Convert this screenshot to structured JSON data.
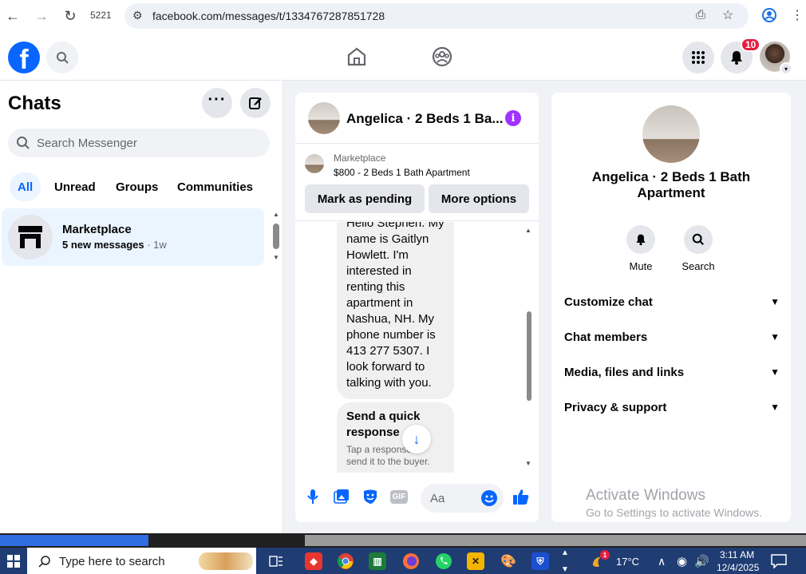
{
  "browser": {
    "tab_count": "5221",
    "url": "facebook.com/messages/t/1334767287851728"
  },
  "header": {
    "logo": "f",
    "notification_count": "10"
  },
  "left": {
    "title": "Chats",
    "search_placeholder": "Search Messenger",
    "tabs": [
      "All",
      "Unread",
      "Groups",
      "Communities"
    ],
    "chats": [
      {
        "name": "Marketplace",
        "preview": "5 new messages",
        "time": " · 1w"
      }
    ]
  },
  "conversation": {
    "title": "Angelica · 2 Beds 1 Ba...",
    "marketplace_label": "Marketplace",
    "listing": "$800 - 2 Beds 1 Bath Apartment",
    "mark_pending": "Mark as pending",
    "more_options": "More options",
    "message1": "Hello Stephen. My name is Gaitlyn Howlett. I'm interested in renting this apartment in Nashua, NH. My phone number is 413 277 5307. I look forward to talking with you.",
    "quick_title": "Send a quick response",
    "quick_sub": "Tap a response to send it to the buyer.",
    "input_placeholder": "Aa"
  },
  "details": {
    "title": "Angelica · 2 Beds 1 Bath Apartment",
    "actions": [
      "Mute",
      "Search"
    ],
    "sections": [
      "Customize chat",
      "Chat members",
      "Media, files and links",
      "Privacy & support"
    ],
    "activate_title": "Activate Windows",
    "activate_sub": "Go to Settings to activate Windows."
  },
  "taskbar": {
    "search_placeholder": "Type here to search",
    "weather_badge": "1",
    "temperature": "17°C",
    "time": "3:11 AM",
    "date": "12/4/2025"
  },
  "colors": {
    "accent": "#0866ff",
    "badge": "#e41e3f",
    "info": "#a033ff",
    "taskbar": "#1f3c73"
  }
}
